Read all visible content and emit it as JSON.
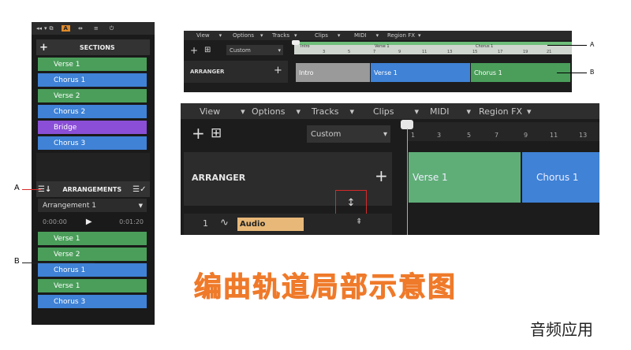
{
  "left_panel": {
    "sections_header": "SECTIONS",
    "sections": [
      {
        "label": "Verse 1",
        "color": "green"
      },
      {
        "label": "Chorus 1",
        "color": "blue"
      },
      {
        "label": "Verse 2",
        "color": "green"
      },
      {
        "label": "Chorus 2",
        "color": "blue"
      },
      {
        "label": "Bridge",
        "color": "purple"
      },
      {
        "label": "Chorus 3",
        "color": "blue"
      }
    ],
    "arrangements_header": "ARRANGEMENTS",
    "arrangement_select": "Arrangement 1",
    "time_start": "0:00:00",
    "time_end": "0:01:20",
    "arrangement_items": [
      {
        "label": "Verse 1",
        "color": "green"
      },
      {
        "label": "Verse 2",
        "color": "green"
      },
      {
        "label": "Chorus 1",
        "color": "blue"
      },
      {
        "label": "Verse 1",
        "color": "green"
      },
      {
        "label": "Chorus 3",
        "color": "blue"
      }
    ]
  },
  "callouts": {
    "a": "A",
    "b": "B"
  },
  "small_view": {
    "menus": [
      "View",
      "Options",
      "Tracks",
      "Clips",
      "MIDI",
      "Region FX"
    ],
    "preset": "Custom",
    "arranger_label": "ARRANGER",
    "ruler_sections": [
      "Intro",
      "Verse 1",
      "Chorus 1"
    ],
    "ruler_ticks": [
      "3",
      "5",
      "7",
      "9",
      "11",
      "13",
      "15",
      "17",
      "19",
      "21"
    ],
    "blocks": [
      {
        "label": "Intro",
        "color": "gray"
      },
      {
        "label": "Verse 1",
        "color": "blue"
      },
      {
        "label": "Chorus 1",
        "color": "green"
      }
    ]
  },
  "big_view": {
    "menus": [
      "View",
      "Options",
      "Tracks",
      "Clips",
      "MIDI",
      "Region FX"
    ],
    "preset": "Custom",
    "arranger_label": "ARRANGER",
    "ruler_ticks": [
      "1",
      "3",
      "5",
      "7",
      "9",
      "11",
      "13"
    ],
    "blocks": [
      {
        "label": "Verse 1",
        "color": "green"
      },
      {
        "label": "Chorus 1",
        "color": "blue"
      }
    ],
    "track_number": "1",
    "track_name": "Audio"
  },
  "caption": "编曲轨道局部示意图",
  "watermark": "音频应用",
  "colors": {
    "green": "#4a9e5a",
    "blue": "#3f82d6",
    "purple": "#8a4fd6",
    "accent": "#ef7a2a",
    "red": "#d62a2a"
  }
}
